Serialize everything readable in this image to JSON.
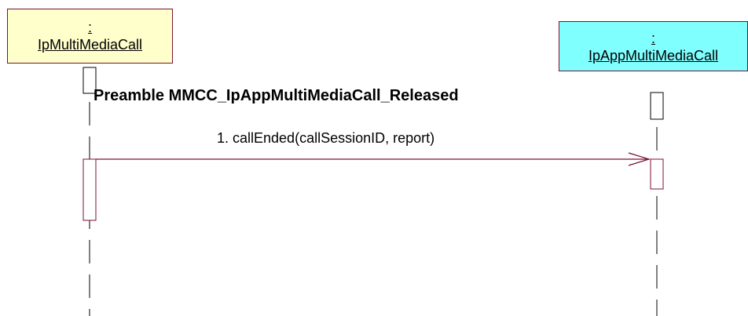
{
  "objects": {
    "caller": {
      "prefix": ":",
      "name": "IpMultiMediaCall",
      "fill": "#ffffcc"
    },
    "app": {
      "prefix": ":",
      "name": "IpAppMultiMediaCall",
      "fill": "#80ffff"
    }
  },
  "preamble": "Preamble MMCC_IpAppMultiMediaCall_Released",
  "message": {
    "label": "1. callEnded(callSessionID, report)"
  },
  "colors": {
    "line": "#7a1030",
    "lifeline": "#000000"
  }
}
